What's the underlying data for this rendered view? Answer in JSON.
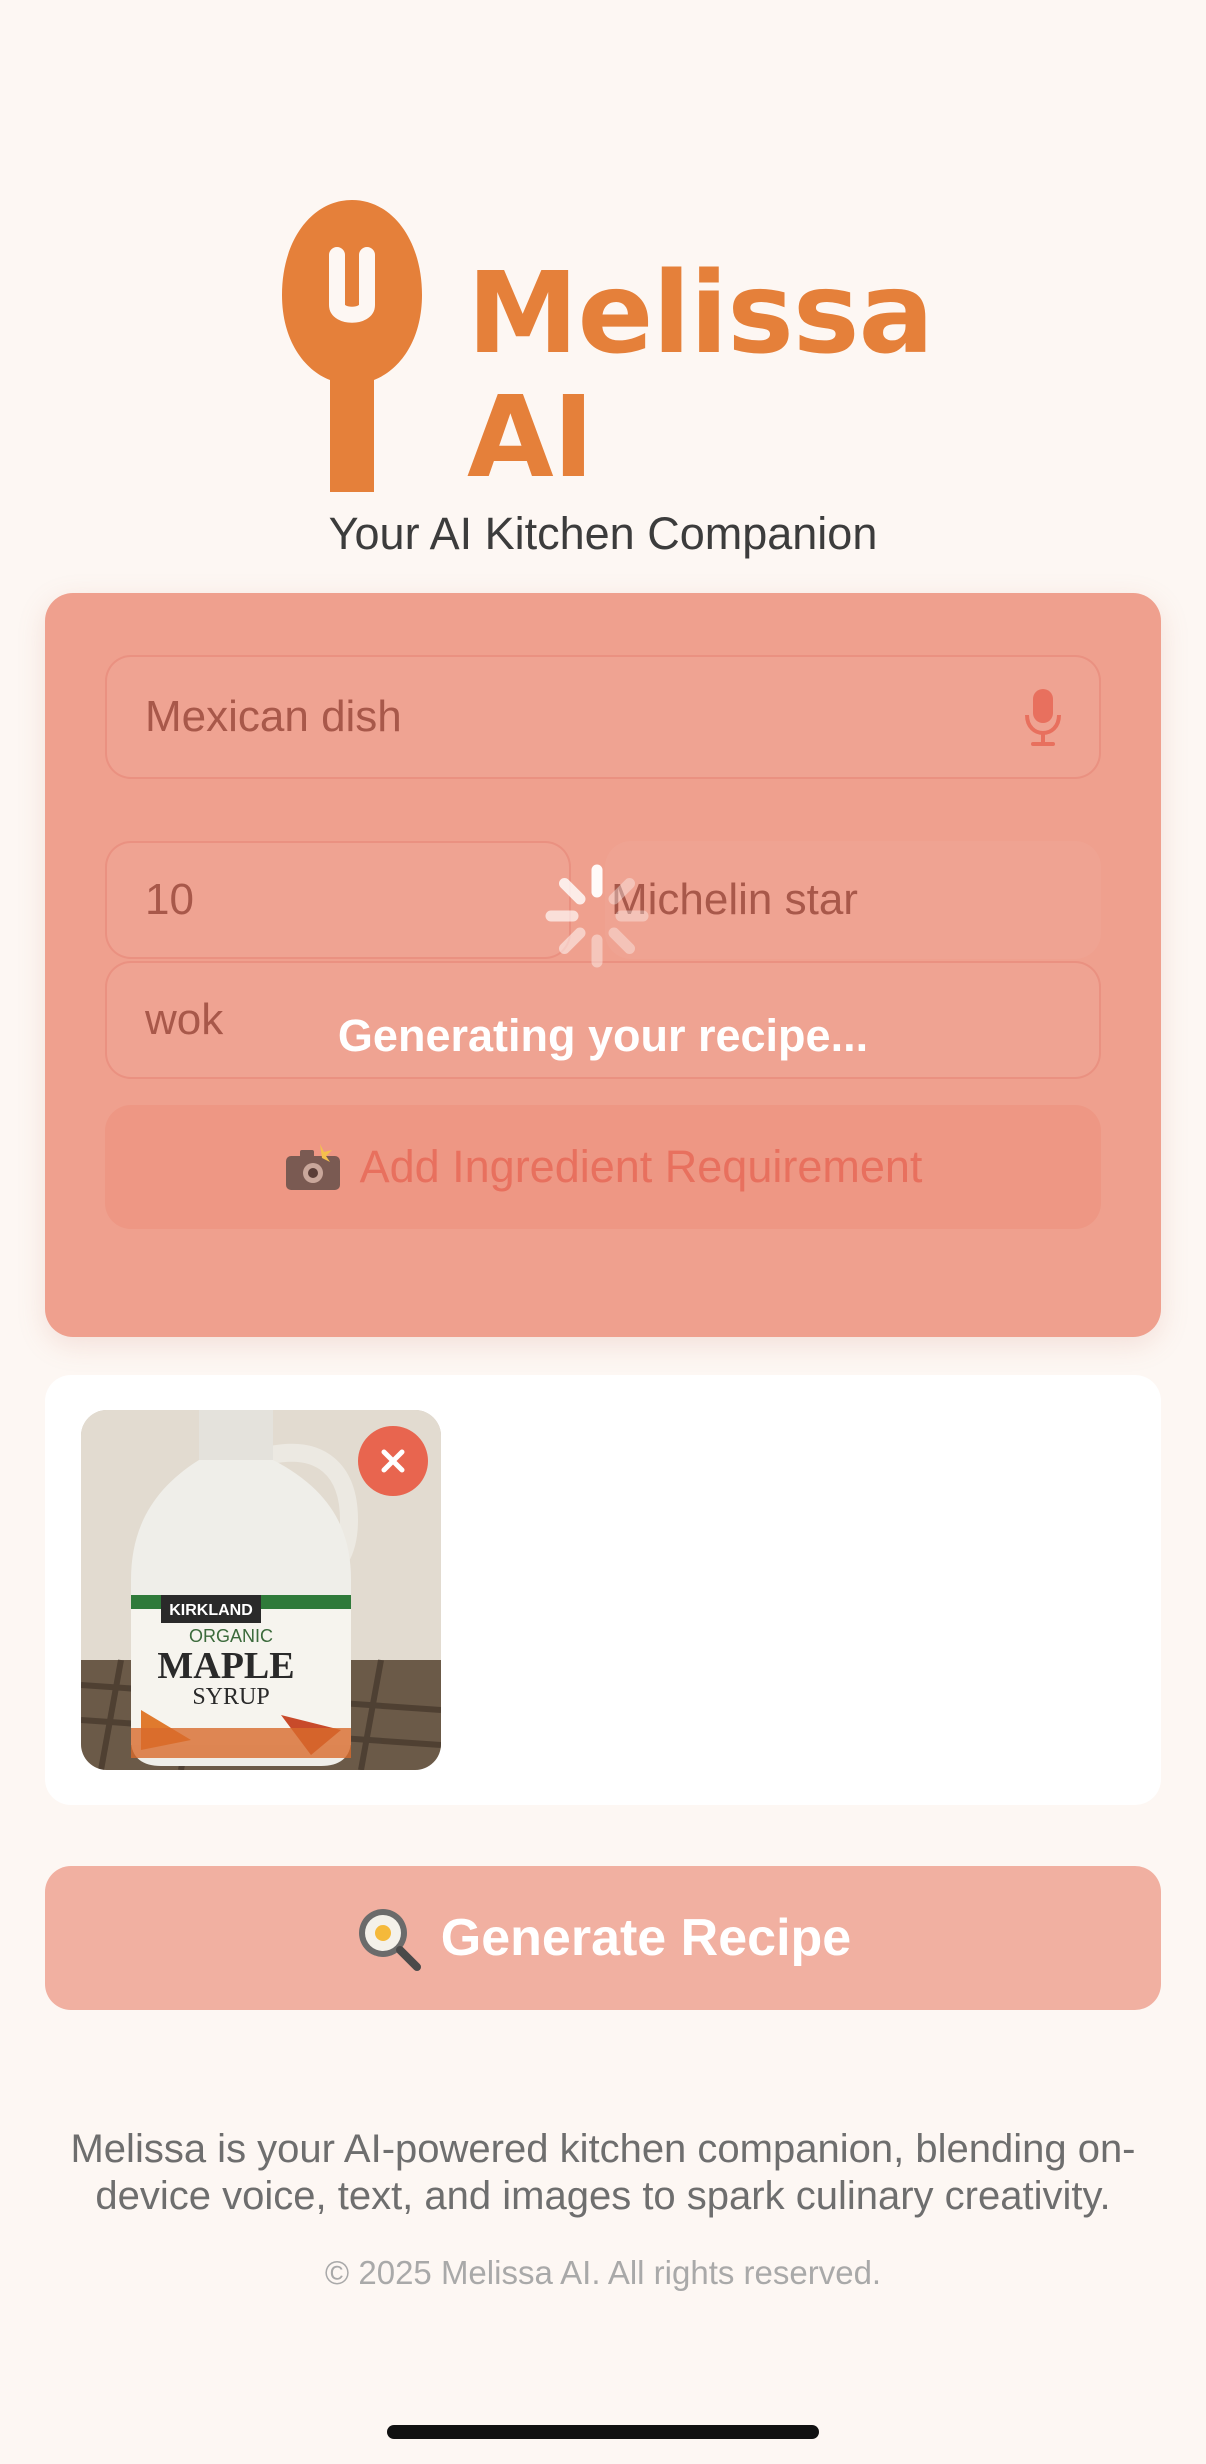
{
  "brand": {
    "name_line1": "Melissa",
    "name_line2": "AI",
    "tagline": "Your AI Kitchen Companion",
    "logo_icon": "spoon-icon",
    "brand_color": "#e5803a"
  },
  "form": {
    "prompt_value": "Mexican dish",
    "prompt_icon": "microphone-icon",
    "servings_value": "10",
    "style_value": "Michelin star",
    "equipment_value": "wok",
    "add_ingredient_label": "Add Ingredient Requirement",
    "add_ingredient_icon": "camera-flash-icon"
  },
  "loading": {
    "text": "Generating your recipe...",
    "icon": "spinner-icon"
  },
  "images": {
    "items": [
      {
        "label_brand": "KIRKLAND",
        "label_line1": "ORGANIC",
        "label_line2": "MAPLE",
        "label_line3": "SYRUP",
        "remove_icon": "close-icon"
      }
    ]
  },
  "generate": {
    "label": "Generate Recipe",
    "icon": "frying-pan-icon"
  },
  "footer": {
    "description": "Melissa is your AI-powered kitchen companion, blending on-device voice, text, and images to spark culinary creativity.",
    "copyright": "© 2025 Melissa AI. All rights reserved."
  },
  "colors": {
    "background": "#fdf7f3",
    "card_overlay": "#efa08e",
    "accent": "#e8705e",
    "generate_button": "#f1b0a1"
  }
}
